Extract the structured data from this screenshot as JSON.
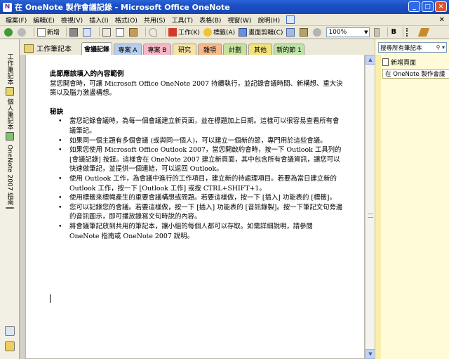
{
  "window": {
    "title": "在 OneNote 製作會議記錄 - Microsoft Office OneNote",
    "controls": {
      "minimize": "_",
      "maximize": "□",
      "close": "✕"
    },
    "app_icon": "N"
  },
  "menubar": {
    "items": [
      "檔案(F)",
      "編輯(E)",
      "檢視(V)",
      "插入(I)",
      "格式(O)",
      "共用(S)",
      "工具(T)",
      "表格(B)",
      "視窗(W)",
      "說明(H)"
    ],
    "close_glyph": "✕"
  },
  "toolbar": {
    "new_label": "新增",
    "work_label": "工作(K)",
    "tag_label": "標籤(A)",
    "clip_label": "畫面剪輯(C)",
    "zoom": "100%",
    "bold": "B"
  },
  "leftnav": {
    "notebooks": [
      "工作筆記本",
      "個人筆記本",
      "OneNote 2007 指南"
    ]
  },
  "notebook": {
    "title": "工作筆記本"
  },
  "sections": [
    {
      "label": "會議記錄",
      "color": "#ffffff",
      "active": true
    },
    {
      "label": "專案 A",
      "color": "#b7cdee"
    },
    {
      "label": "專案 B",
      "color": "#f6b7c6"
    },
    {
      "label": "研究",
      "color": "#f8e3a6"
    },
    {
      "label": "雜項",
      "color": "#f5b98a"
    },
    {
      "label": "計劃",
      "color": "#c6e29c"
    },
    {
      "label": "其他",
      "color": "#f3e27a"
    },
    {
      "label": "新的節 1",
      "color": "#bfe3a7"
    }
  ],
  "content": {
    "heading1": "此節應該填入的內容範例",
    "intro": "當您開會時，可讓 Microsoft Office OneNote 2007 持續執行，並記錄會議時間、新構想、重大決策以及腦力激盪構想。",
    "heading2": "秘訣",
    "tips": [
      "當您記錄會議時，為每一個會議建立新頁面，並在標題加上日期。這樣可以很容易查看所有會議筆記。",
      "如果同一個主題有多個會議 (或與同一個人)，可以建立一個新的節，專門用於這些會議。",
      "如果您使用 Microsoft Office Outlook 2007，當您開啟約會時，按一下 Outlook 工具列的 [會議記錄] 按鈕。這樣會在 OneNote 2007 建立新頁面，其中包含所有會議資訊，讓您可以快速做筆記，並提供一個連結，可以返回 Outlook。",
      "使用 Outlook 工作，為會議中進行的工作項目，建立新的待處理項目。若要為當日建立新的 Outlook 工作，按一下 [Outlook 工作] 或按 CTRL+SHIFT+1。",
      "使用標籤來標幟產生的重要會議構想或問題。若要這樣做，按一下 [插入] 功能表的 [標籤]。",
      "您可以記錄您的會議。若要這樣做，按一下 [插入] 功能表的 [音訊錄製]。按一下筆記文句旁邊的音訊圖示，即可播放錄寫文句時說的內容。",
      "將會議筆記放到共用的筆記本，讓小組的每個人都可以存取。如需詳細說明，請參閱 OneNote 指南或 OneNote 2007 說明。"
    ]
  },
  "rightpane": {
    "search_placeholder": "搜尋所有筆記本",
    "search_icon": "search-icon",
    "new_page_label": "新增頁面",
    "pages": [
      "在 OneNote 製作會議"
    ]
  }
}
